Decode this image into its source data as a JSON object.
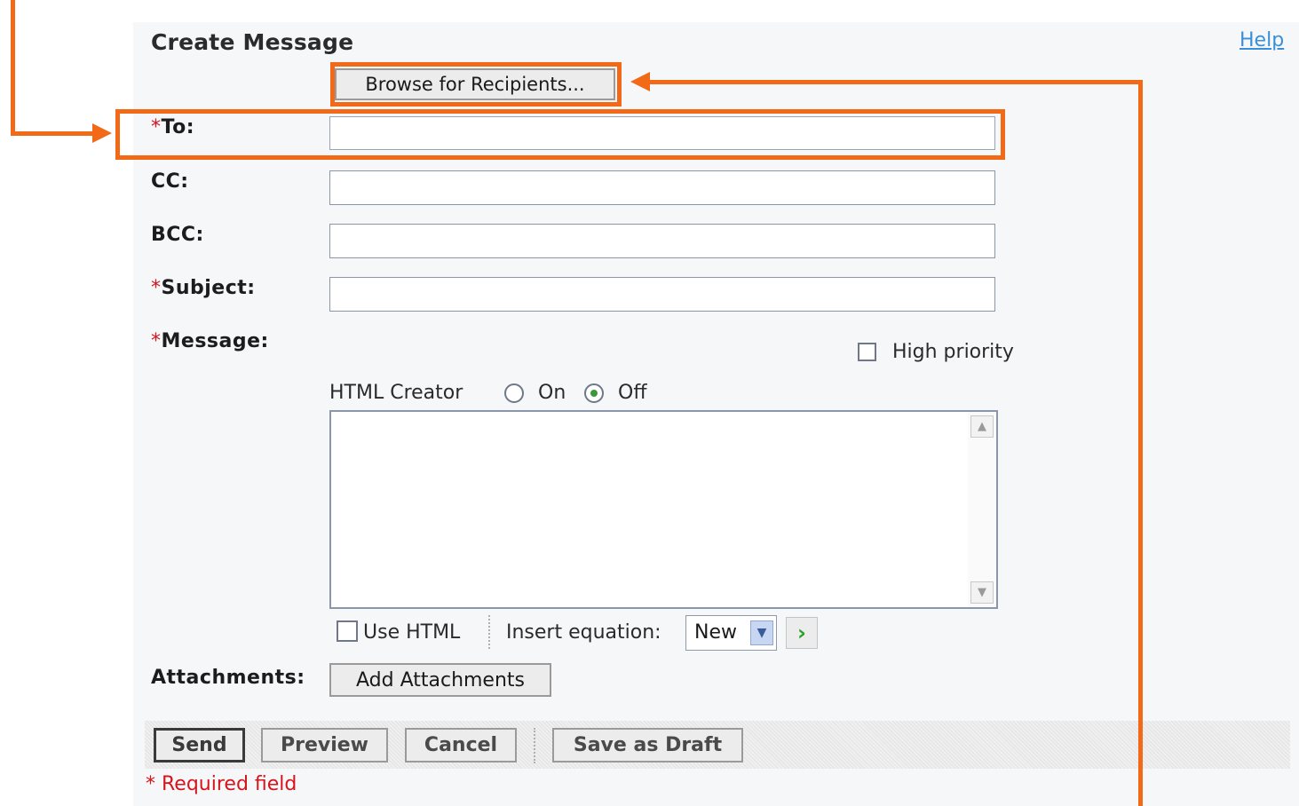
{
  "header": {
    "title": "Create Message",
    "help_link": "Help"
  },
  "browse_button": "Browse for Recipients...",
  "fields": {
    "to": {
      "asterisk": "*",
      "label": "To:",
      "value": ""
    },
    "cc": {
      "label": "CC:",
      "value": ""
    },
    "bcc": {
      "label": "BCC:",
      "value": ""
    },
    "subject": {
      "asterisk": "*",
      "label": "Subject:",
      "value": ""
    },
    "message": {
      "asterisk": "*",
      "label": "Message:",
      "value": ""
    }
  },
  "high_priority": {
    "label": "High priority",
    "checked": false
  },
  "html_creator": {
    "label": "HTML Creator",
    "on_label": "On",
    "off_label": "Off",
    "selected": "Off"
  },
  "use_html": {
    "label": "Use HTML",
    "checked": false
  },
  "insert_equation": {
    "label": "Insert equation:",
    "selected": "New"
  },
  "attachments": {
    "label": "Attachments:",
    "button": "Add Attachments"
  },
  "actions": {
    "send": "Send",
    "preview": "Preview",
    "cancel": "Cancel",
    "save_draft": "Save as Draft"
  },
  "footer": {
    "required_note": "* Required field"
  },
  "colors": {
    "annotation": "#f26a17",
    "required": "#d6141c",
    "link": "#3b8fd6"
  },
  "icons": {
    "go": "go-arrow-icon",
    "dropdown": "chevron-down-icon",
    "scroll_up": "scroll-up-icon",
    "scroll_down": "scroll-down-icon"
  }
}
